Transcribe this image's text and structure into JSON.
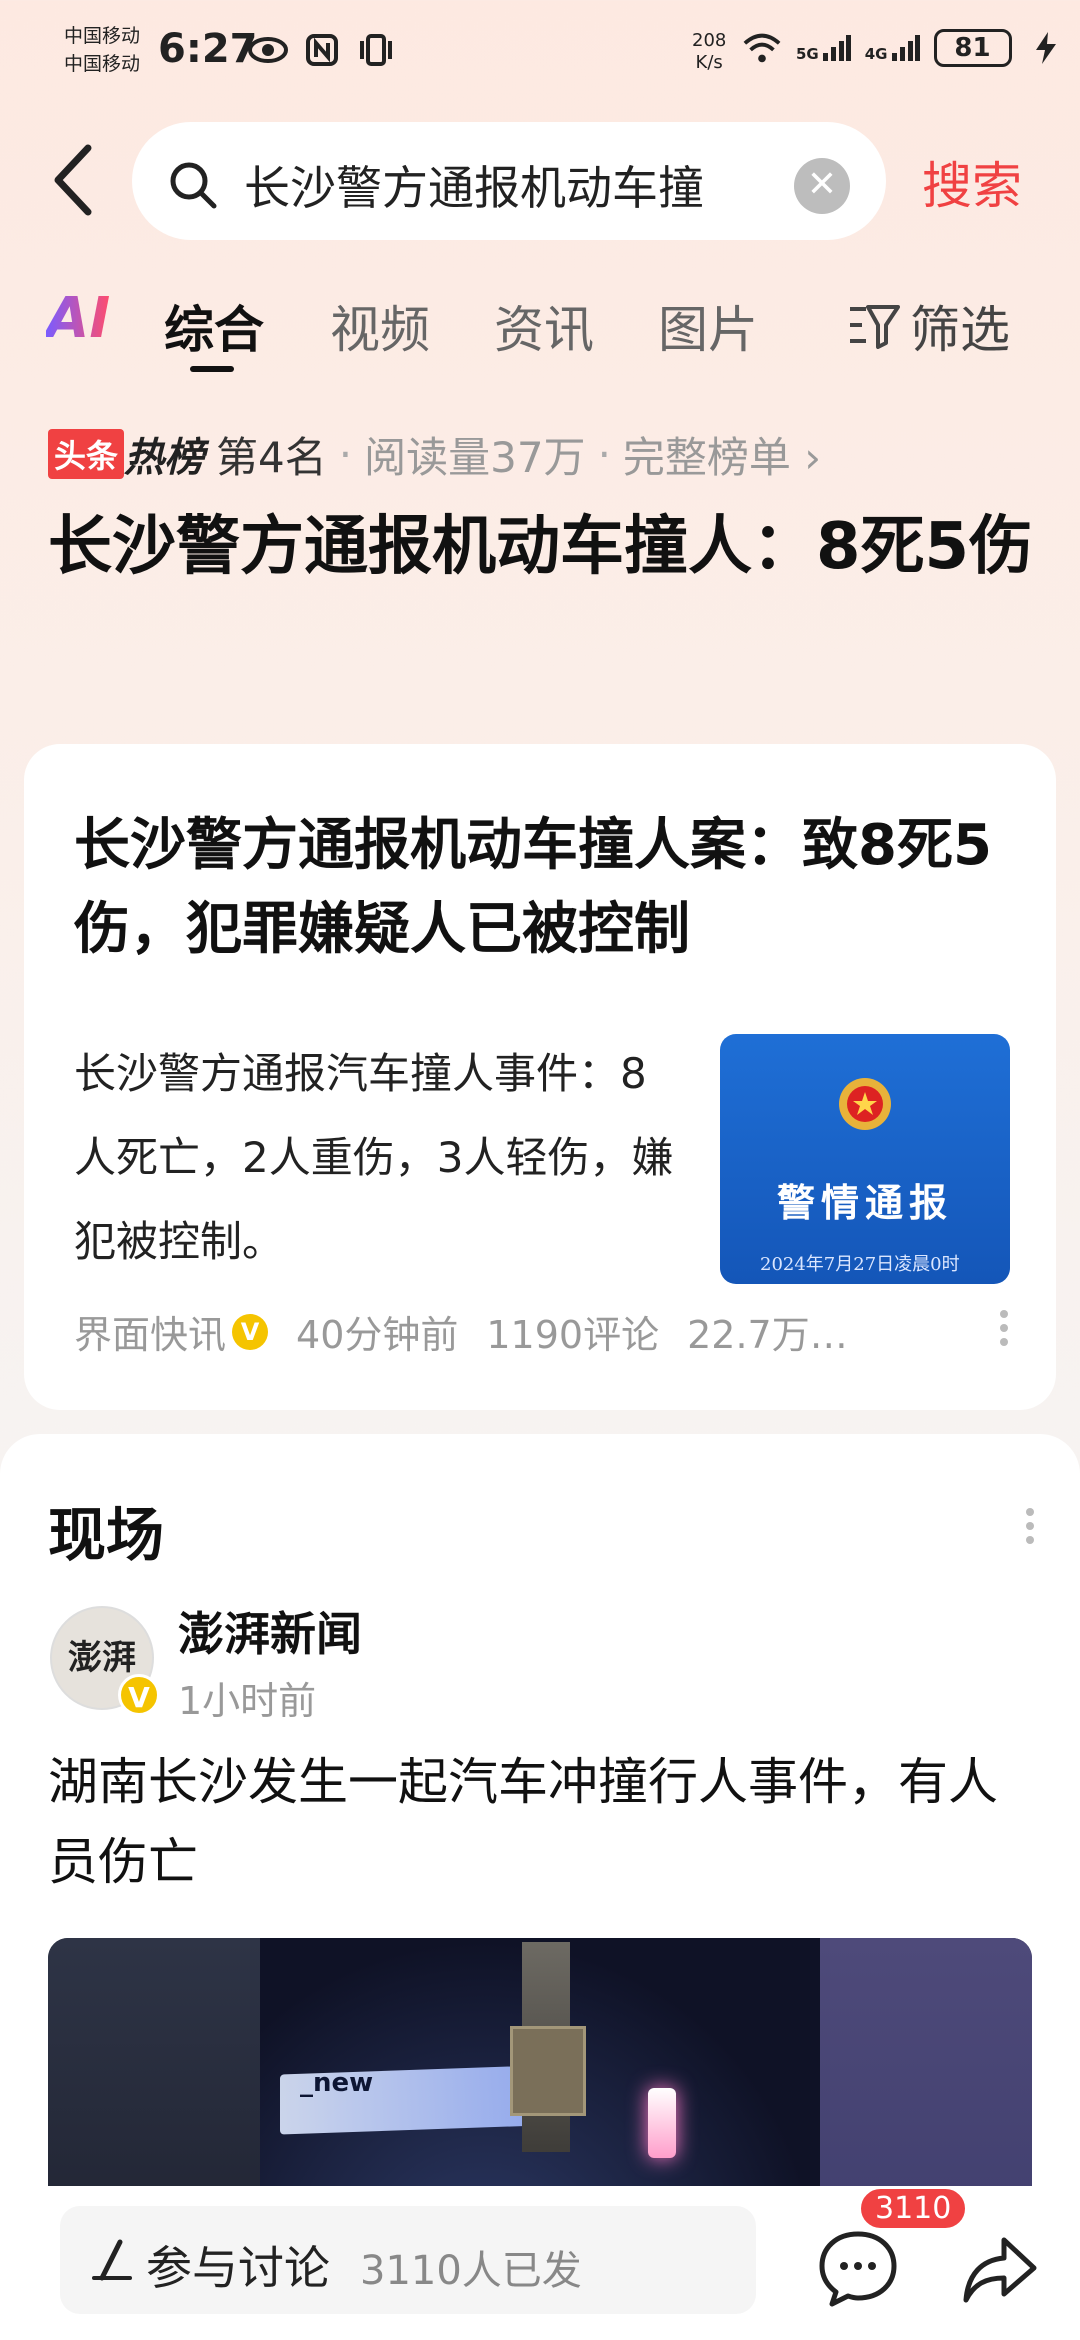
{
  "status_bar": {
    "carrier1": "中国移动",
    "carrier2": "中国移动",
    "time": "6:27",
    "net_speed_value": "208",
    "net_speed_unit": "K/s",
    "sig1": "5G",
    "sig2": "4G",
    "battery": "81"
  },
  "search": {
    "query": "长沙警方通报机动车撞",
    "button_label": "搜索"
  },
  "tabs": {
    "ai_label": "AI",
    "items": [
      "综合",
      "视频",
      "资讯",
      "图片"
    ],
    "active": "综合",
    "filter_label": "筛选"
  },
  "hot": {
    "badge": "头条",
    "word": "热榜",
    "rank": "第4名",
    "reads": "阅读量37万",
    "full_list": "完整榜单 ›"
  },
  "headline": "长沙警方通报机动车撞人：8死5伤",
  "card1": {
    "title": "长沙警方通报机动车撞人案：致8死5伤，犯罪嫌疑人已被控制",
    "summary": "长沙警方通报汽车撞人事件：8人死亡，2人重伤，3人轻伤，嫌犯被控制。",
    "thumb_title": "警情通报",
    "thumb_date": "2024年7月27日凌晨0时",
    "source": "界面快讯",
    "time": "40分钟前",
    "comments": "1190评论",
    "reads": "22.7万…"
  },
  "card2": {
    "section_title": "现场",
    "avatar_text": "澎湃",
    "author": "澎湃新闻",
    "time": "1小时前",
    "text": "湖南长沙发生一起汽车冲撞行人事件，有人员伤亡",
    "video_canopy_text": "_new"
  },
  "bottom": {
    "discuss_label": "参与讨论",
    "discuss_count": "3110人已发",
    "comment_badge": "3110"
  },
  "colors": {
    "accent_red": "#f04142",
    "verified_yellow": "#f5c400"
  }
}
